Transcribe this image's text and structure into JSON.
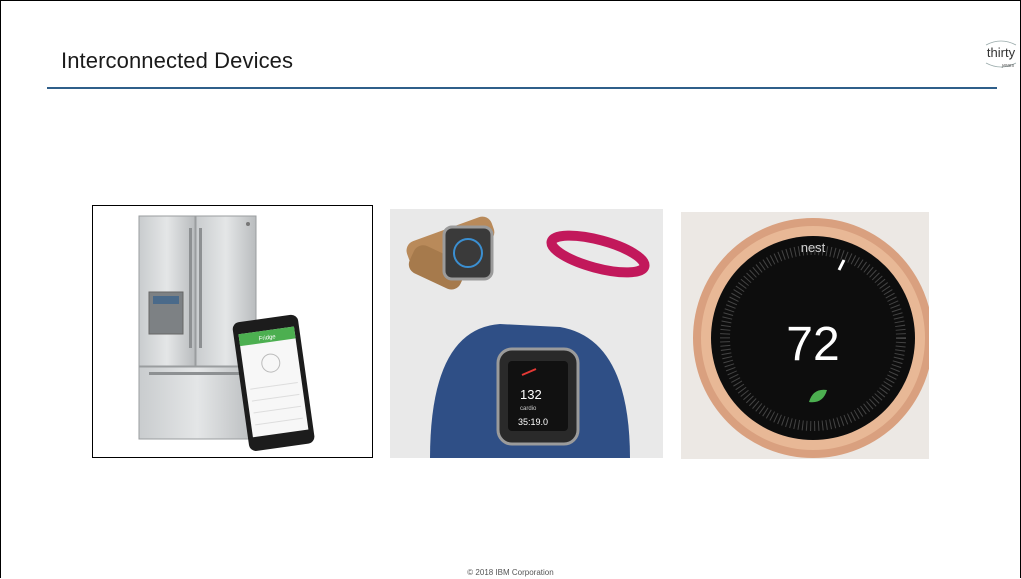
{
  "slide": {
    "title": "Interconnected Devices",
    "footer": "© 2018 IBM Corporation"
  },
  "logo": {
    "word_top": "thirty",
    "word_bottom": "years"
  },
  "images": [
    {
      "id": "fridge",
      "phone_header": "Fridge"
    },
    {
      "id": "wearables",
      "screen_value": "132",
      "screen_label": "cardio",
      "screen_time": "35:19.0"
    },
    {
      "id": "thermostat",
      "brand": "nest",
      "temperature": "72"
    }
  ],
  "colors": {
    "rule": "#2f5f8a",
    "app_green": "#4caf50",
    "band_blue": "#2f4f86",
    "band_pink": "#c2185b",
    "copper": "#d9a07f"
  }
}
